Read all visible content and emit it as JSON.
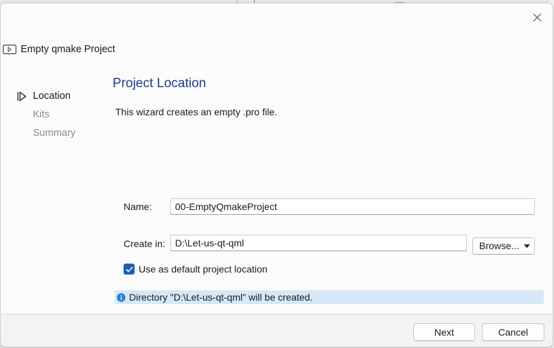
{
  "dialog": {
    "title": "Empty qmake Project",
    "close_icon": "close-icon"
  },
  "steps": [
    {
      "label": "Location",
      "state": "active",
      "icon": "play-outline-icon"
    },
    {
      "label": "Kits",
      "state": "inactive"
    },
    {
      "label": "Summary",
      "state": "inactive"
    }
  ],
  "page": {
    "title": "Project Location",
    "description": "This wizard creates an empty .pro file."
  },
  "form": {
    "name_label": "Name:",
    "name_value": "00-EmptyQmakeProject",
    "create_in_label": "Create in:",
    "create_in_value": "D:\\Let-us-qt-qml",
    "browse_label": "Browse...",
    "default_location_label": "Use as default project location",
    "default_location_checked": true
  },
  "info": {
    "icon": "info-icon",
    "message": "Directory \"D:\\Let-us-qt-qml\" will be created."
  },
  "footer": {
    "next_label": "Next",
    "cancel_label": "Cancel"
  },
  "colors": {
    "title_blue": "#1c3f8c",
    "checkbox_blue": "#1f5fb3",
    "info_bg": "#d6e8f7"
  }
}
